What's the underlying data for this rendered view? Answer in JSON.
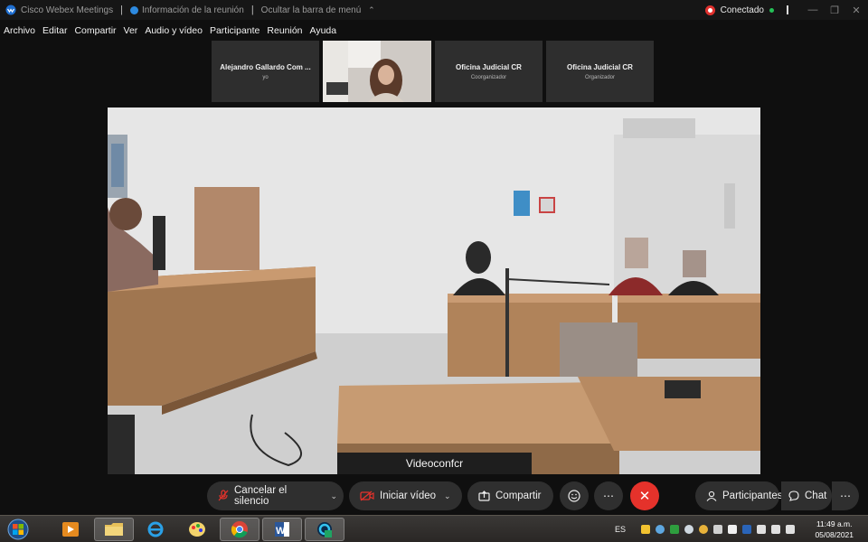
{
  "titlebar": {
    "app_title": "Cisco Webex Meetings",
    "meeting_info": "Información de la reunión",
    "hide_menu": "Ocultar la barra de menú",
    "status": "Conectado"
  },
  "menu": [
    "Archivo",
    "Editar",
    "Compartir",
    "Ver",
    "Audio y vídeo",
    "Participante",
    "Reunión",
    "Ayuda"
  ],
  "participants": [
    {
      "name": "Alejandro Gallardo Com ...",
      "role": "yo"
    },
    {
      "name": "",
      "role": ""
    },
    {
      "name": "Oficina Judicial CR",
      "role": "Coorganizador"
    },
    {
      "name": "Oficina Judicial CR",
      "role": "Organizador"
    }
  ],
  "main_video": {
    "label": "Videoconfcr"
  },
  "controls": {
    "mute": "Cancelar el silencio",
    "video": "Iniciar vídeo",
    "share": "Compartir",
    "participants": "Participantes",
    "chat": "Chat",
    "more": "⋯"
  },
  "taskbar": {
    "language": "ES",
    "time": "11:49 a.m.",
    "date": "05/08/2021"
  },
  "colors": {
    "end_call": "#e5322b",
    "connected": "#24c157",
    "recording": "#e0312e"
  }
}
